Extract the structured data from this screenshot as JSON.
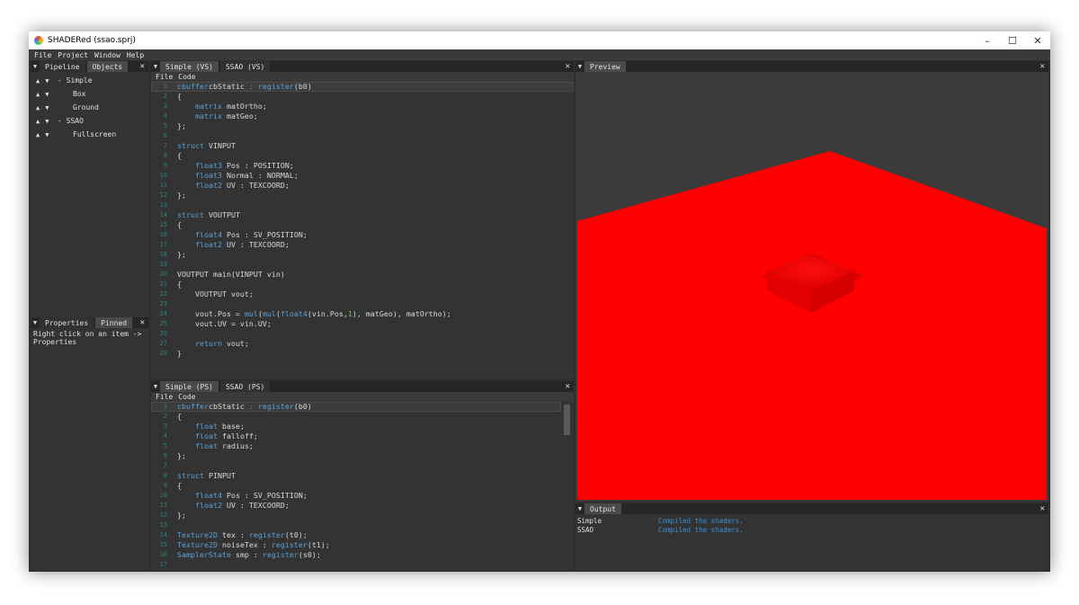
{
  "window": {
    "title": "SHADERed (ssao.sprj)",
    "controls": [
      "–",
      "☐",
      "✕"
    ]
  },
  "menu": [
    "File",
    "Project",
    "Window",
    "Help"
  ],
  "left_panel": {
    "tabs": [
      "Pipeline",
      "Objects"
    ],
    "active_tab": "Objects",
    "items": [
      {
        "label": "- Simple"
      },
      {
        "label": "Box"
      },
      {
        "label": "Ground"
      },
      {
        "label": "- SSAO"
      },
      {
        "label": "Fullscreen"
      }
    ]
  },
  "properties_panel": {
    "tabs": [
      "Properties",
      "Pinned"
    ],
    "text": "Right click on an item -> Properties"
  },
  "vs_editor": {
    "tabs": [
      "Simple (VS)",
      "SSAO (VS)"
    ],
    "menu": [
      "File",
      "Code"
    ],
    "lines": [
      [
        [
          "kw",
          "cbuffer"
        ],
        [
          "",
          "cbStatic "
        ],
        [
          "hl-op",
          ":"
        ],
        [
          "fn",
          " register"
        ],
        [
          "",
          "(b0)"
        ]
      ],
      [
        [
          "",
          "{"
        ]
      ],
      [
        [
          "tp",
          "    matrix"
        ],
        [
          "",
          " matOrtho;"
        ]
      ],
      [
        [
          "tp",
          "    matrix"
        ],
        [
          "",
          " matGeo;"
        ]
      ],
      [
        [
          "",
          "};"
        ]
      ],
      [
        [
          "",
          ""
        ]
      ],
      [
        [
          "kw",
          "struct"
        ],
        [
          "",
          " VINPUT"
        ]
      ],
      [
        [
          "",
          "{"
        ]
      ],
      [
        [
          "tp",
          "    float3"
        ],
        [
          "",
          " Pos : POSITION;"
        ]
      ],
      [
        [
          "tp",
          "    float3"
        ],
        [
          "",
          " Normal : NORMAL;"
        ]
      ],
      [
        [
          "tp",
          "    float2"
        ],
        [
          "",
          " UV : TEXCOORD;"
        ]
      ],
      [
        [
          "",
          "};"
        ]
      ],
      [
        [
          "",
          ""
        ]
      ],
      [
        [
          "kw",
          "struct"
        ],
        [
          "",
          " VOUTPUT"
        ]
      ],
      [
        [
          "",
          "{"
        ]
      ],
      [
        [
          "tp",
          "    float4"
        ],
        [
          "",
          " Pos : SV_POSITION;"
        ]
      ],
      [
        [
          "tp",
          "    float2"
        ],
        [
          "",
          " UV : TEXCOORD;"
        ]
      ],
      [
        [
          "",
          "};"
        ]
      ],
      [
        [
          "",
          ""
        ]
      ],
      [
        [
          "",
          "VOUTPUT main(VINPUT vin)"
        ]
      ],
      [
        [
          "",
          "{"
        ]
      ],
      [
        [
          "",
          "    VOUTPUT vout;"
        ]
      ],
      [
        [
          "",
          ""
        ]
      ],
      [
        [
          "",
          "    vout.Pos = "
        ],
        [
          "fn",
          "mul"
        ],
        [
          "",
          "("
        ],
        [
          "fn",
          "mul"
        ],
        [
          "",
          "("
        ],
        [
          "tp",
          "float4"
        ],
        [
          "",
          "(vin.Pos,"
        ],
        [
          "num",
          "1"
        ],
        [
          "",
          "), matGeo), matOrtho);"
        ]
      ],
      [
        [
          "",
          "    vout.UV = vin.UV;"
        ]
      ],
      [
        [
          "",
          ""
        ]
      ],
      [
        [
          "kw",
          "    return"
        ],
        [
          "",
          " vout;"
        ]
      ],
      [
        [
          "",
          "}"
        ]
      ]
    ]
  },
  "ps_editor": {
    "tabs": [
      "Simple (PS)",
      "SSAO (PS)"
    ],
    "menu": [
      "File",
      "Code"
    ],
    "lines": [
      [
        [
          "kw",
          "cbuffer"
        ],
        [
          "",
          "cbStatic "
        ],
        [
          "hl-op",
          ":"
        ],
        [
          "fn",
          " register"
        ],
        [
          "",
          "(b0)"
        ]
      ],
      [
        [
          "",
          "{"
        ]
      ],
      [
        [
          "tp",
          "    float"
        ],
        [
          "",
          " base;"
        ]
      ],
      [
        [
          "tp",
          "    float"
        ],
        [
          "",
          " falloff;"
        ]
      ],
      [
        [
          "tp",
          "    float"
        ],
        [
          "",
          " radius;"
        ]
      ],
      [
        [
          "",
          "};"
        ]
      ],
      [
        [
          "",
          ""
        ]
      ],
      [
        [
          "kw",
          "struct"
        ],
        [
          "",
          " PINPUT"
        ]
      ],
      [
        [
          "",
          "{"
        ]
      ],
      [
        [
          "tp",
          "    float4"
        ],
        [
          "",
          " Pos : SV_POSITION;"
        ]
      ],
      [
        [
          "tp",
          "    float2"
        ],
        [
          "",
          " UV : TEXCOORD;"
        ]
      ],
      [
        [
          "",
          "};"
        ]
      ],
      [
        [
          "",
          ""
        ]
      ],
      [
        [
          "tp",
          "Texture2D"
        ],
        [
          "",
          " tex : "
        ],
        [
          "fn",
          "register"
        ],
        [
          "",
          "(t0);"
        ]
      ],
      [
        [
          "tp",
          "Texture2D"
        ],
        [
          "",
          " noiseTex : "
        ],
        [
          "fn",
          "register"
        ],
        [
          "",
          "(t1);"
        ]
      ],
      [
        [
          "tp",
          "SamplerState"
        ],
        [
          "",
          " smp : "
        ],
        [
          "fn",
          "register"
        ],
        [
          "",
          "(s0);"
        ]
      ],
      [
        [
          "",
          ""
        ]
      ]
    ]
  },
  "preview": {
    "tab": "Preview",
    "floor_color": "#ff0000",
    "box_color": "#e80000"
  },
  "output": {
    "tab": "Output",
    "rows": [
      {
        "source": "Simple",
        "message": "Compiled the shaders."
      },
      {
        "source": "SSAO",
        "message": "Compiled the shaders."
      }
    ]
  }
}
